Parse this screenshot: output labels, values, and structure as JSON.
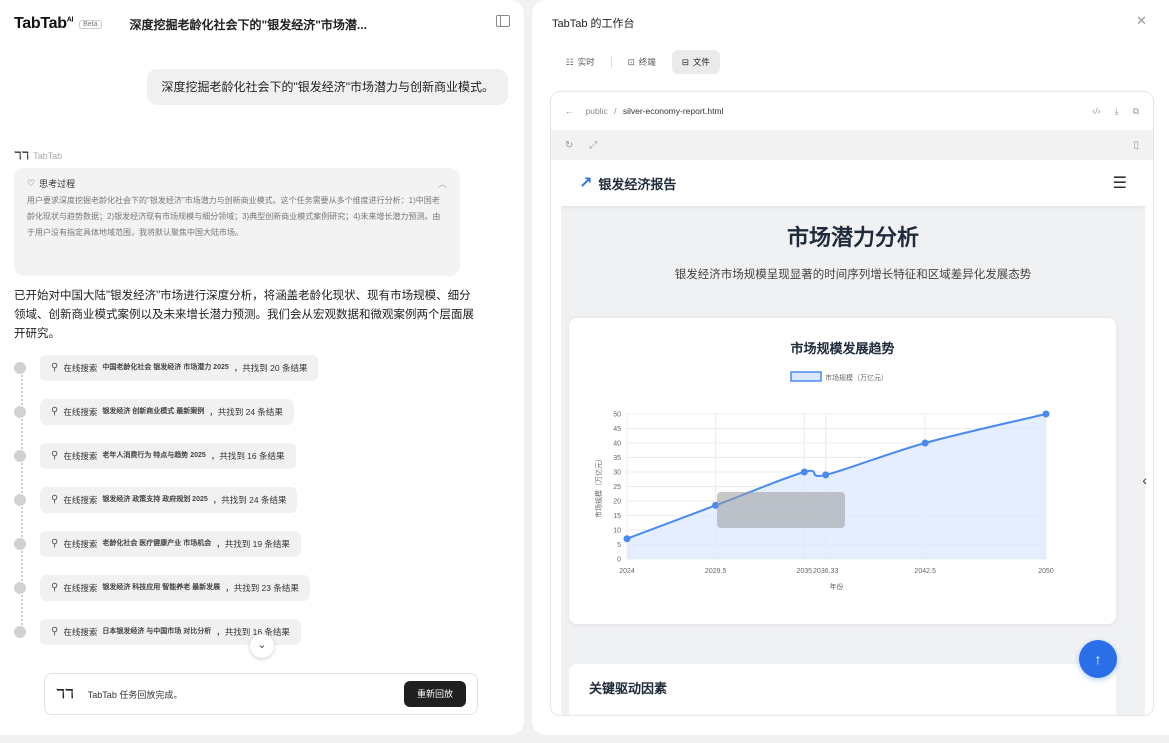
{
  "left": {
    "logo": "TabTab",
    "logo_sup": "AI",
    "badge": "Beta",
    "title": "深度挖掘老龄化社会下的\"银发经济\"市场潜...",
    "user_message": "深度挖掘老龄化社会下的\"银发经济\"市场潜力与创新商业模式。",
    "ai_name": "TabTab",
    "thinking": {
      "label": "思考过程",
      "text": "用户要求深度挖掘老龄化社会下的\"银发经济\"市场潜力与创新商业模式。这个任务需要从多个维度进行分析：1)中国老龄化现状与趋势数据；2)银发经济现有市场规模与细分领域；3)典型创新商业模式案例研究；4)未来增长潜力预测。由于用户没有指定具体地域范围，我将默认聚焦中国大陆市场。"
    },
    "paragraph": "已开始对中国大陆\"银发经济\"市场进行深度分析，将涵盖老龄化现状、现有市场规模、细分领域、创新商业模式案例以及未来增长潜力预测。我们会从宏观数据和微观案例两个层面展开研究。",
    "searches": [
      {
        "label": "在线搜索",
        "keywords": "中国老龄化社会 银发经济 市场潜力 2025",
        "result": "，共找到 20 条结果"
      },
      {
        "label": "在线搜索",
        "keywords": "银发经济 创新商业模式 最新案例",
        "result": "，共找到 24 条结果"
      },
      {
        "label": "在线搜索",
        "keywords": "老年人消费行为 特点与趋势 2025",
        "result": "，共找到 16 条结果"
      },
      {
        "label": "在线搜索",
        "keywords": "银发经济 政策支持 政府规划 2025",
        "result": "，共找到 24 条结果"
      },
      {
        "label": "在线搜索",
        "keywords": "老龄化社会 医疗健康产业 市场机会",
        "result": "，共找到 19 条结果"
      },
      {
        "label": "在线搜索",
        "keywords": "银发经济 科技应用 智能养老 最新发展",
        "result": "，共找到 23 条结果"
      },
      {
        "label": "在线搜索",
        "keywords": "日本银发经济 与中国市场 对比分析",
        "result": "，共找到 16 条结果"
      }
    ],
    "bottom": {
      "logo": "TT",
      "status": "TabTab 任务回放完成。",
      "replay_button": "重新回放"
    }
  },
  "right": {
    "title": "TabTab 的工作台",
    "tabs": [
      {
        "icon": "list-icon",
        "label": "实时"
      },
      {
        "icon": "terminal-icon",
        "label": "终端"
      },
      {
        "icon": "folder-icon",
        "label": "文件"
      }
    ],
    "active_tab": "文件",
    "path_root": "public",
    "path_sep": "/",
    "path_file": "silver-economy-report.html",
    "page": {
      "brand": "银发经济报告",
      "title": "市场潜力分析",
      "subtitle": "银发经济市场规模呈现显著的时间序列增长特征和区域差异化发展态势",
      "section2": "关键驱动因素"
    }
  },
  "chart_data": {
    "type": "area",
    "title": "市场规模发展趋势",
    "series": [
      {
        "name": "市场规模（万亿元）",
        "color": "#4a8af0"
      }
    ],
    "x": [
      2024,
      2029.5,
      2035,
      2036.33,
      2042.5,
      2050
    ],
    "x_ticks": [
      "2024",
      "2029.5",
      "2035",
      "2036.33",
      "2042.5",
      "2050"
    ],
    "y": [
      7,
      18.5,
      30,
      29,
      40,
      50
    ],
    "xlabel": "年份",
    "ylabel": "市场规模（万亿元）",
    "ylim": [
      0,
      50
    ],
    "y_ticks": [
      0,
      5,
      10,
      15,
      20,
      25,
      30,
      35,
      40,
      45,
      50
    ],
    "grid": true,
    "legend": "top"
  }
}
